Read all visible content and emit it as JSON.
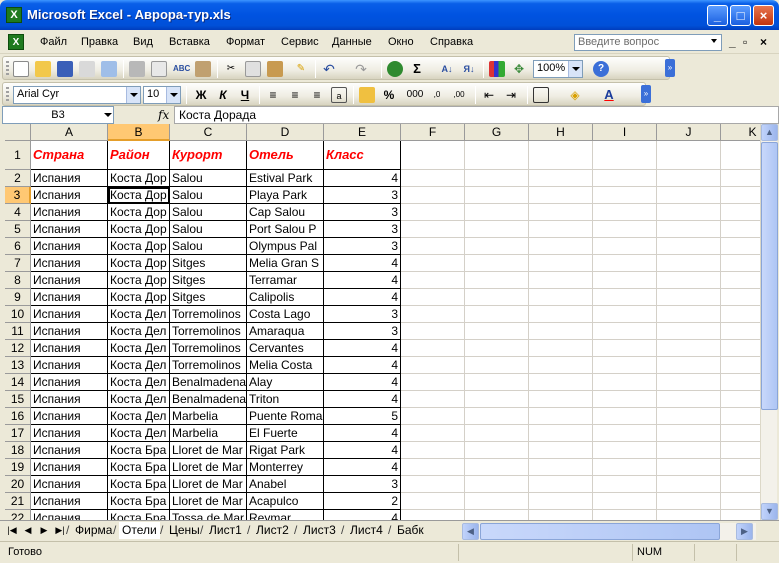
{
  "window": {
    "title": "Microsoft Excel - Аврора-тур.xls",
    "app_icon": "excel-icon"
  },
  "menu": {
    "items": [
      "Файл",
      "Правка",
      "Вид",
      "Вставка",
      "Формат",
      "Сервис",
      "Данные",
      "Окно",
      "Справка"
    ],
    "help_placeholder": "Введите вопрос"
  },
  "standard_toolbar": {
    "zoom": "100%"
  },
  "formatting_toolbar": {
    "font_name": "Arial Cyr",
    "font_size": "10",
    "bold": "Ж",
    "italic": "К",
    "underline": "Ч",
    "percent": "%",
    "thousands": "000"
  },
  "formula_bar": {
    "name_box": "B3",
    "fx_label": "fx",
    "content": "Коста Дорада"
  },
  "grid": {
    "columns": [
      "A",
      "B",
      "C",
      "D",
      "E",
      "F",
      "G",
      "H",
      "I",
      "J",
      "K"
    ],
    "selected_column": "B",
    "selected_row": 3,
    "header_row": [
      "Страна",
      "Район",
      "Курорт",
      "Отель",
      "Класс"
    ],
    "rows": [
      {
        "n": "2",
        "a": "Испания",
        "b": "Коста Дор",
        "c": "Salou",
        "d": "Estival Park",
        "e": "4"
      },
      {
        "n": "3",
        "a": "Испания",
        "b": "Коста Дор",
        "c": "Salou",
        "d": "Playa Park",
        "e": "3"
      },
      {
        "n": "4",
        "a": "Испания",
        "b": "Коста Дор",
        "c": "Salou",
        "d": "Cap Salou",
        "e": "3"
      },
      {
        "n": "5",
        "a": "Испания",
        "b": "Коста Дор",
        "c": "Salou",
        "d": "Port Salou P",
        "e": "3"
      },
      {
        "n": "6",
        "a": "Испания",
        "b": "Коста Дор",
        "c": "Salou",
        "d": "Olympus Pal",
        "e": "3"
      },
      {
        "n": "7",
        "a": "Испания",
        "b": "Коста Дор",
        "c": "Sitges",
        "d": "Melia Gran S",
        "e": "4"
      },
      {
        "n": "8",
        "a": "Испания",
        "b": "Коста Дор",
        "c": "Sitges",
        "d": "Terramar",
        "e": "4"
      },
      {
        "n": "9",
        "a": "Испания",
        "b": "Коста Дор",
        "c": "Sitges",
        "d": "Calipolis",
        "e": "4"
      },
      {
        "n": "10",
        "a": "Испания",
        "b": "Коста Дел",
        "c": "Torremolinos",
        "d": "Costa Lago",
        "e": "3"
      },
      {
        "n": "11",
        "a": "Испания",
        "b": "Коста Дел",
        "c": "Torremolinos",
        "d": "Amaraqua",
        "e": "3"
      },
      {
        "n": "12",
        "a": "Испания",
        "b": "Коста Дел",
        "c": "Torremolinos",
        "d": "Cervantes",
        "e": "4"
      },
      {
        "n": "13",
        "a": "Испания",
        "b": "Коста Дел",
        "c": "Torremolinos",
        "d": "Melia Costa",
        "e": "4"
      },
      {
        "n": "14",
        "a": "Испания",
        "b": "Коста Дел",
        "c": "Benalmadena",
        "d": "Alay",
        "e": "4"
      },
      {
        "n": "15",
        "a": "Испания",
        "b": "Коста Дел",
        "c": "Benalmadena",
        "d": "Triton",
        "e": "4"
      },
      {
        "n": "16",
        "a": "Испания",
        "b": "Коста Дел",
        "c": "Marbelia",
        "d": "Puente Roma",
        "e": "5"
      },
      {
        "n": "17",
        "a": "Испания",
        "b": "Коста Дел",
        "c": "Marbelia",
        "d": "El Fuerte",
        "e": "4"
      },
      {
        "n": "18",
        "a": "Испания",
        "b": "Коста Бра",
        "c": "Lloret de Mar",
        "d": "Rigat Park",
        "e": "4"
      },
      {
        "n": "19",
        "a": "Испания",
        "b": "Коста Бра",
        "c": "Lloret de Mar",
        "d": "Monterrey",
        "e": "4"
      },
      {
        "n": "20",
        "a": "Испания",
        "b": "Коста Бра",
        "c": "Lloret de Mar",
        "d": "Anabel",
        "e": "3"
      },
      {
        "n": "21",
        "a": "Испания",
        "b": "Коста Бра",
        "c": "Lloret de Mar",
        "d": "Acapulco",
        "e": "2"
      },
      {
        "n": "22",
        "a": "Испания",
        "b": "Коста Бра",
        "c": "Tossa de Mar",
        "d": "Reymar",
        "e": "4"
      }
    ]
  },
  "sheet_tabs": [
    "Фирма",
    "Отели",
    "Цены",
    "Лист1",
    "Лист2",
    "Лист3",
    "Лист4",
    "Бабк"
  ],
  "active_sheet": "Отели",
  "status": {
    "text": "Готово",
    "num": "NUM"
  },
  "colors": {
    "header_text": "#ff0000",
    "selection_header": "#ffc873",
    "titlebar": "#0053e1"
  }
}
